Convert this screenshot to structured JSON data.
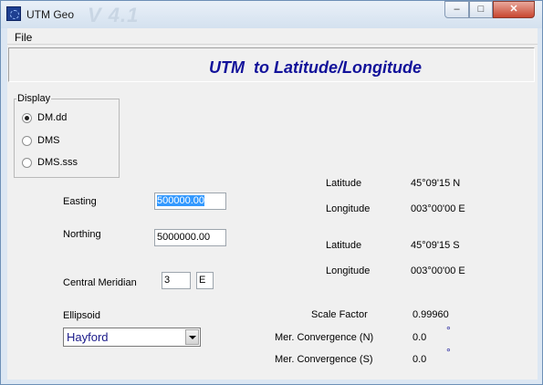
{
  "window": {
    "title": "UTM Geo",
    "watermark": "V 4.1",
    "controls": {
      "minimize": "–",
      "maximize": "□",
      "close": "✕"
    }
  },
  "menu": {
    "file": "File"
  },
  "header": {
    "title": "UTM  to Latitude/Longitude",
    "color": "#12129a"
  },
  "display": {
    "legend": "Display",
    "options": [
      {
        "label": "DM.dd",
        "selected": true
      },
      {
        "label": "DMS",
        "selected": false
      },
      {
        "label": "DMS.sss",
        "selected": false
      }
    ]
  },
  "inputs": {
    "easting_label": "Easting",
    "easting_value": "500000.00",
    "northing_label": "Northing",
    "northing_value": "5000000.00",
    "central_meridian_label": "Central Meridian",
    "central_meridian_value": "3",
    "central_meridian_hemisphere": "E",
    "ellipsoid_label": "Ellipsoid",
    "ellipsoid_value": "Hayford"
  },
  "results": {
    "north": {
      "latitude_label": "Latitude",
      "latitude_value": "45°09'15 N",
      "longitude_label": "Longitude",
      "longitude_value": "003°00'00 E"
    },
    "south": {
      "latitude_label": "Latitude",
      "latitude_value": "45°09'15 S",
      "longitude_label": "Longitude",
      "longitude_value": "003°00'00 E"
    },
    "scale_factor_label": "Scale Factor",
    "scale_factor_value": "0.99960",
    "mer_conv_n_label": "Mer. Convergence (N)",
    "mer_conv_n_value": "0.0",
    "mer_conv_s_label": "Mer. Convergence (S)",
    "mer_conv_s_value": "0.0",
    "degree_symbol": "°"
  }
}
